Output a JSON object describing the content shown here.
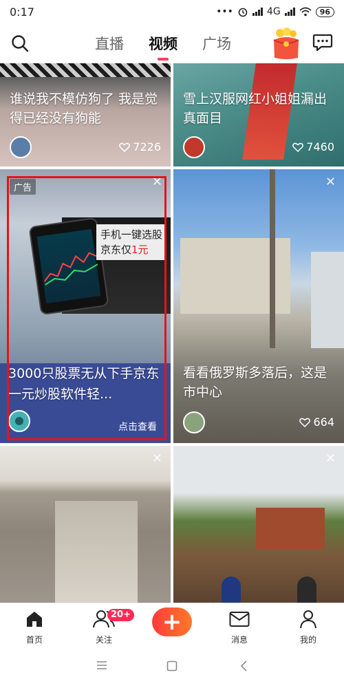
{
  "status_bar": {
    "time": "0:17",
    "network": "4G",
    "battery": "96"
  },
  "top_nav": {
    "tabs": [
      {
        "label": "直播",
        "active": false
      },
      {
        "label": "视频",
        "active": true
      },
      {
        "label": "广场",
        "active": false
      }
    ],
    "icons": [
      "search-icon",
      "red-envelope-icon",
      "message-bubble-icon"
    ]
  },
  "feed": {
    "cards": [
      {
        "title": "谁说我不模仿狗了 我是觉得已经没有狗能",
        "likes": "7226"
      },
      {
        "title": "雪上汉服网红小姐姐漏出真面目",
        "likes": "7460"
      },
      {
        "ad_label": "广告",
        "title": "3000只股票无从下手京东一元炒股软件轻...",
        "cta": "点击查看",
        "banner_line1": "手机一键选股",
        "banner_line2_prefix": "京东仅",
        "banner_line2_highlight": "1元"
      },
      {
        "title": "看看俄罗斯多落后，这是市中心",
        "likes": "664"
      },
      {
        "title": ""
      },
      {
        "title": ""
      }
    ]
  },
  "bottom_nav": {
    "items": [
      {
        "label": "首页",
        "icon": "home-icon"
      },
      {
        "label": "关注",
        "icon": "people-icon",
        "badge": "20+"
      },
      {
        "label": "",
        "icon": "plus-icon"
      },
      {
        "label": "消息",
        "icon": "mail-icon"
      },
      {
        "label": "我的",
        "icon": "person-icon"
      }
    ]
  },
  "colors": {
    "accent": "#ff3b5c",
    "ad_border": "#e4141b",
    "ad_bg": "#3a4b95"
  }
}
